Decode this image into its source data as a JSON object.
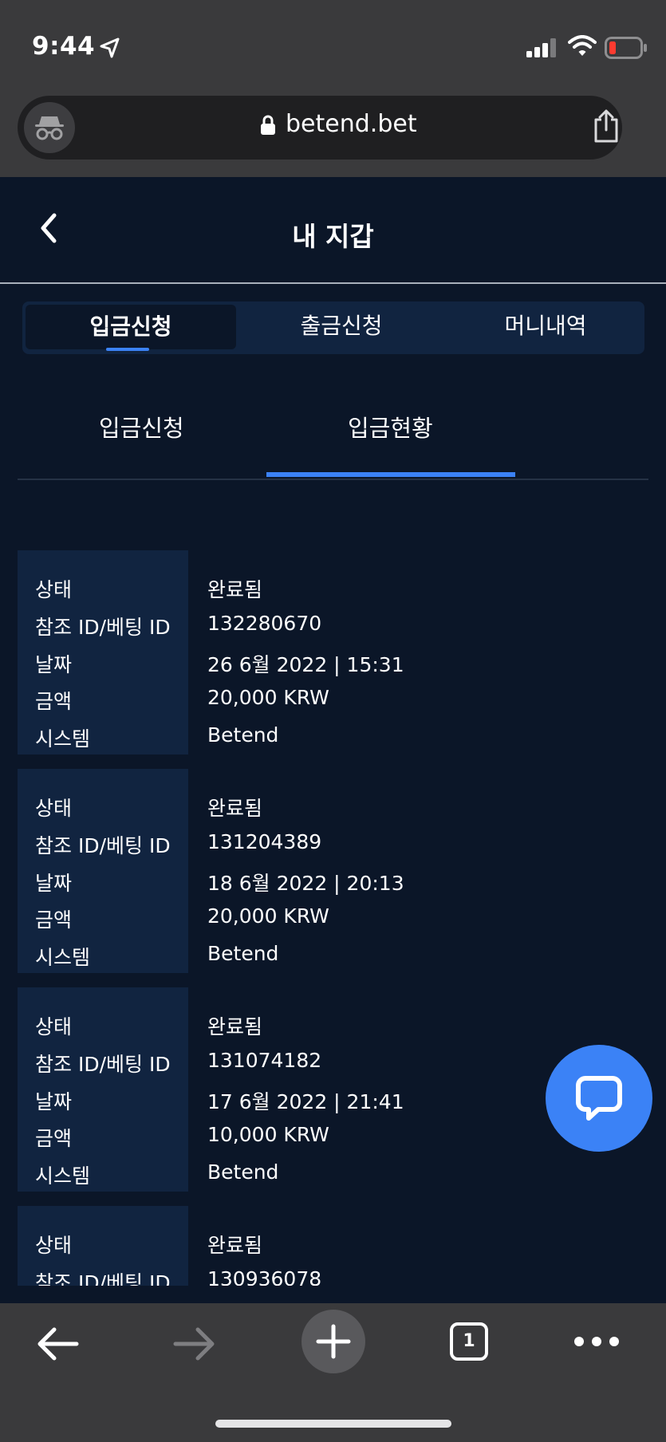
{
  "status_bar": {
    "time": "9:44"
  },
  "browser": {
    "url": "betend.bet",
    "open_tabs_count": "1"
  },
  "header": {
    "title": "내 지갑"
  },
  "tabs": [
    {
      "label": "입금신청",
      "active": true
    },
    {
      "label": "출금신청",
      "active": false
    },
    {
      "label": "머니내역",
      "active": false
    }
  ],
  "subtabs": [
    {
      "label": "입금신청",
      "active": false
    },
    {
      "label": "입금현황",
      "active": true
    }
  ],
  "field_labels": {
    "status": "상태",
    "ref_id": "참조 ID/베팅 ID",
    "date": "날짜",
    "amount": "금액",
    "system": "시스템"
  },
  "transactions": [
    {
      "status": "완료됨",
      "ref_id": "132280670",
      "date": "26 6월 2022 | 15:31",
      "amount": "20,000 KRW",
      "system": "Betend"
    },
    {
      "status": "완료됨",
      "ref_id": "131204389",
      "date": "18 6월 2022 | 20:13",
      "amount": "20,000 KRW",
      "system": "Betend"
    },
    {
      "status": "완료됨",
      "ref_id": "131074182",
      "date": "17 6월 2022 | 21:41",
      "amount": "10,000 KRW",
      "system": "Betend"
    },
    {
      "status": "완료됨",
      "ref_id": "130936078",
      "date": "",
      "amount": "",
      "system": ""
    }
  ],
  "colors": {
    "background": "#0b1628",
    "panel": "#112440",
    "accent": "#3b82f6",
    "browser_chrome": "#3a3a3c"
  },
  "icons": [
    "location-arrow-icon",
    "signal-icon",
    "wifi-icon",
    "battery-low-icon",
    "incognito-icon",
    "lock-icon",
    "share-icon",
    "back-chevron-icon",
    "chat-icon",
    "arrow-left-icon",
    "arrow-right-icon",
    "plus-icon",
    "more-icon"
  ]
}
